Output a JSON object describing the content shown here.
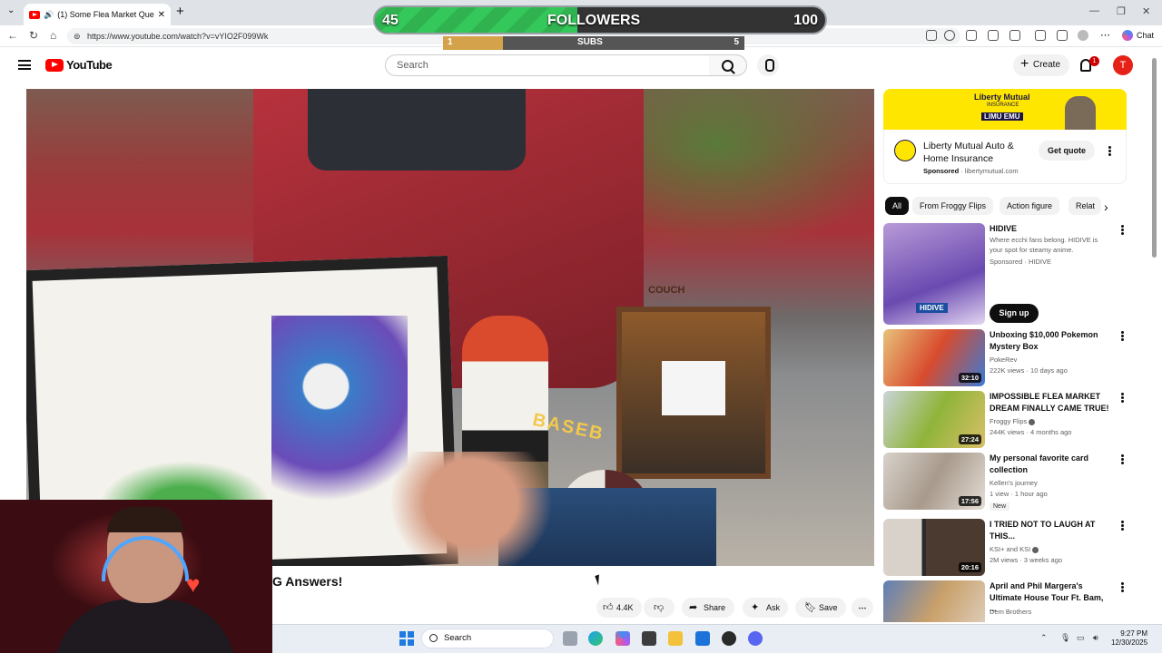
{
  "browser": {
    "tab_title": "(1) Some Flea Market Questio",
    "url": "https://www.youtube.com/watch?v=vYIO2F099Wk",
    "profile_label": "Chat"
  },
  "overlay": {
    "followers_label": "FOLLOWERS",
    "followers_current": "45",
    "followers_goal": "100",
    "followers_progress": 0.45,
    "subs_label": "SUBS",
    "subs_current": "1",
    "subs_goal": "5",
    "subs_progress": 0.2
  },
  "youtube": {
    "logo_text": "YouTube",
    "search_placeholder": "Search",
    "create_label": "Create",
    "notification_count": "1",
    "avatar_initial": "T"
  },
  "video": {
    "title_visible": "G Answers!",
    "jersey_text": "COUCH",
    "box_text": "BASEB",
    "actions": {
      "like_count": "4.4K",
      "share_label": "Share",
      "ask_label": "Ask",
      "save_label": "Save"
    }
  },
  "sidebar": {
    "ad": {
      "banner_brand": "Liberty Mutual",
      "banner_sub": "INSURANCE",
      "banner_tag": "LIMU EMU",
      "title": "Liberty Mutual Auto & Home Insurance",
      "sponsored": "Sponsored",
      "domain": "libertymutual.com",
      "cta": "Get quote"
    },
    "chips": [
      "All",
      "From Froggy Flips",
      "Action figure",
      "Relat"
    ],
    "recommendations": [
      {
        "title": "HIDIVE",
        "desc": "Where ecchi fans belong. HIDIVE is your spot for steamy anime.",
        "meta1": "Sponsored · HIDIVE",
        "cta": "Sign up",
        "thumb_text": "HIDIVE",
        "duration": ""
      },
      {
        "title": "Unboxing $10,000 Pokemon Mystery Box",
        "channel": "PokeRev",
        "stats": "222K views · 10 days ago",
        "duration": "32:10"
      },
      {
        "title": "IMPOSSIBLE FLEA MARKET DREAM FINALLY CAME TRUE!",
        "channel": "Froggy Flips",
        "stats": "244K views · 4 months ago",
        "duration": "27:24"
      },
      {
        "title": "My personal favorite card collection",
        "channel": "Kellen's journey",
        "stats": "1 view · 1 hour ago",
        "badge": "New",
        "duration": "17:56"
      },
      {
        "title": "I TRIED NOT TO LAUGH AT THIS...",
        "channel": "KSI+ and KSI",
        "stats": "2M views · 3 weeks ago",
        "duration": "20:16"
      },
      {
        "title": "April and Phil Margera's Ultimate House Tour Ft. Bam, ...",
        "channel": "Dem Brothers",
        "stats": "",
        "duration": ""
      }
    ]
  },
  "taskbar": {
    "search_label": "Search",
    "time": "9:27 PM",
    "date": "12/30/2025"
  },
  "colors": {
    "youtube_red": "#ff0000",
    "followers_green": "#34c759",
    "subs_gold": "#d4a24a",
    "ad_yellow": "#ffe600"
  }
}
